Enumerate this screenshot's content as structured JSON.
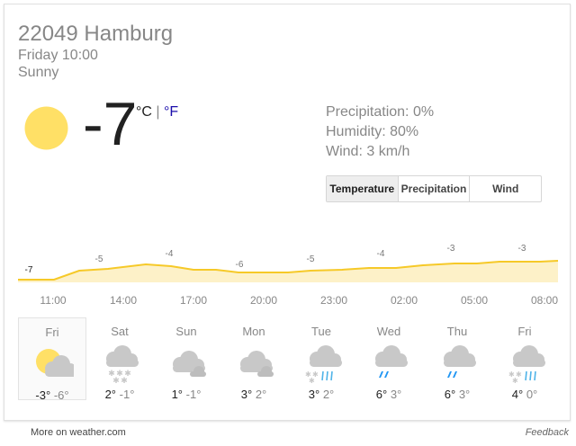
{
  "location": "22049 Hamburg",
  "time": "Friday 10:00",
  "condition": "Sunny",
  "current": {
    "temperature": "-7",
    "unit_c": "°C",
    "unit_sep": " | ",
    "unit_f": "°F",
    "icon": "sun-icon"
  },
  "details": {
    "precipitation": "Precipitation: 0%",
    "humidity": "Humidity: 80%",
    "wind": "Wind: 3 km/h"
  },
  "tabs": [
    "Temperature",
    "Precipitation",
    "Wind"
  ],
  "active_tab": "Temperature",
  "chart_data": {
    "type": "area",
    "x": [
      "11:00",
      "14:00",
      "17:00",
      "20:00",
      "23:00",
      "02:00",
      "05:00",
      "08:00"
    ],
    "labels": [
      -7,
      -5,
      -4,
      -6,
      -5,
      -4,
      -3,
      -3
    ],
    "colors": {
      "line": "#f6c928",
      "fill": "#fdf1c8"
    }
  },
  "forecast": [
    {
      "day": "Fri",
      "hi": "-3°",
      "lo": "-6°",
      "icon": "partly-cloudy-icon"
    },
    {
      "day": "Sat",
      "hi": "2°",
      "lo": "-1°",
      "icon": "snow-icon"
    },
    {
      "day": "Sun",
      "hi": "1°",
      "lo": "-1°",
      "icon": "cloudy-icon"
    },
    {
      "day": "Mon",
      "hi": "3°",
      "lo": "2°",
      "icon": "cloudy-icon"
    },
    {
      "day": "Tue",
      "hi": "3°",
      "lo": "2°",
      "icon": "rain-snow-icon"
    },
    {
      "day": "Wed",
      "hi": "6°",
      "lo": "3°",
      "icon": "rain-icon"
    },
    {
      "day": "Thu",
      "hi": "6°",
      "lo": "3°",
      "icon": "rain-icon"
    },
    {
      "day": "Fri",
      "hi": "4°",
      "lo": "0°",
      "icon": "rain-snow-icon"
    }
  ],
  "footer": {
    "source": "More on weather.com",
    "feedback": "Feedback"
  }
}
